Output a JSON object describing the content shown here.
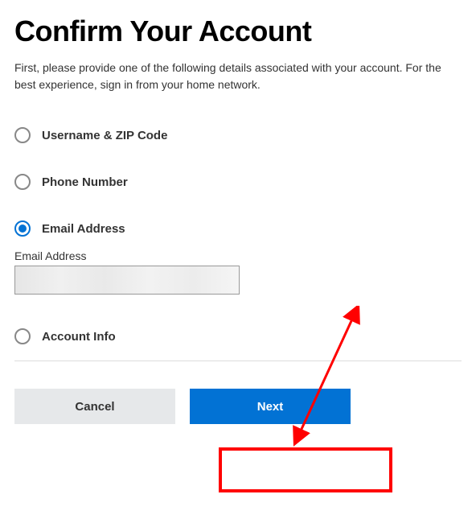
{
  "title": "Confirm Your Account",
  "subtitle": "First, please provide one of the following details associated with your account. For the best experience, sign in from your home network.",
  "options": {
    "username_zip": "Username & ZIP Code",
    "phone": "Phone Number",
    "email": "Email Address",
    "account_info": "Account Info"
  },
  "selected_option": "email",
  "email_field": {
    "label": "Email Address",
    "value": ""
  },
  "buttons": {
    "cancel": "Cancel",
    "next": "Next"
  },
  "annotation": {
    "highlight_target": "next-button",
    "arrow": true
  },
  "colors": {
    "primary": "#0272d4",
    "annotation": "#ff0000",
    "cancel_bg": "#e6e8ea"
  }
}
